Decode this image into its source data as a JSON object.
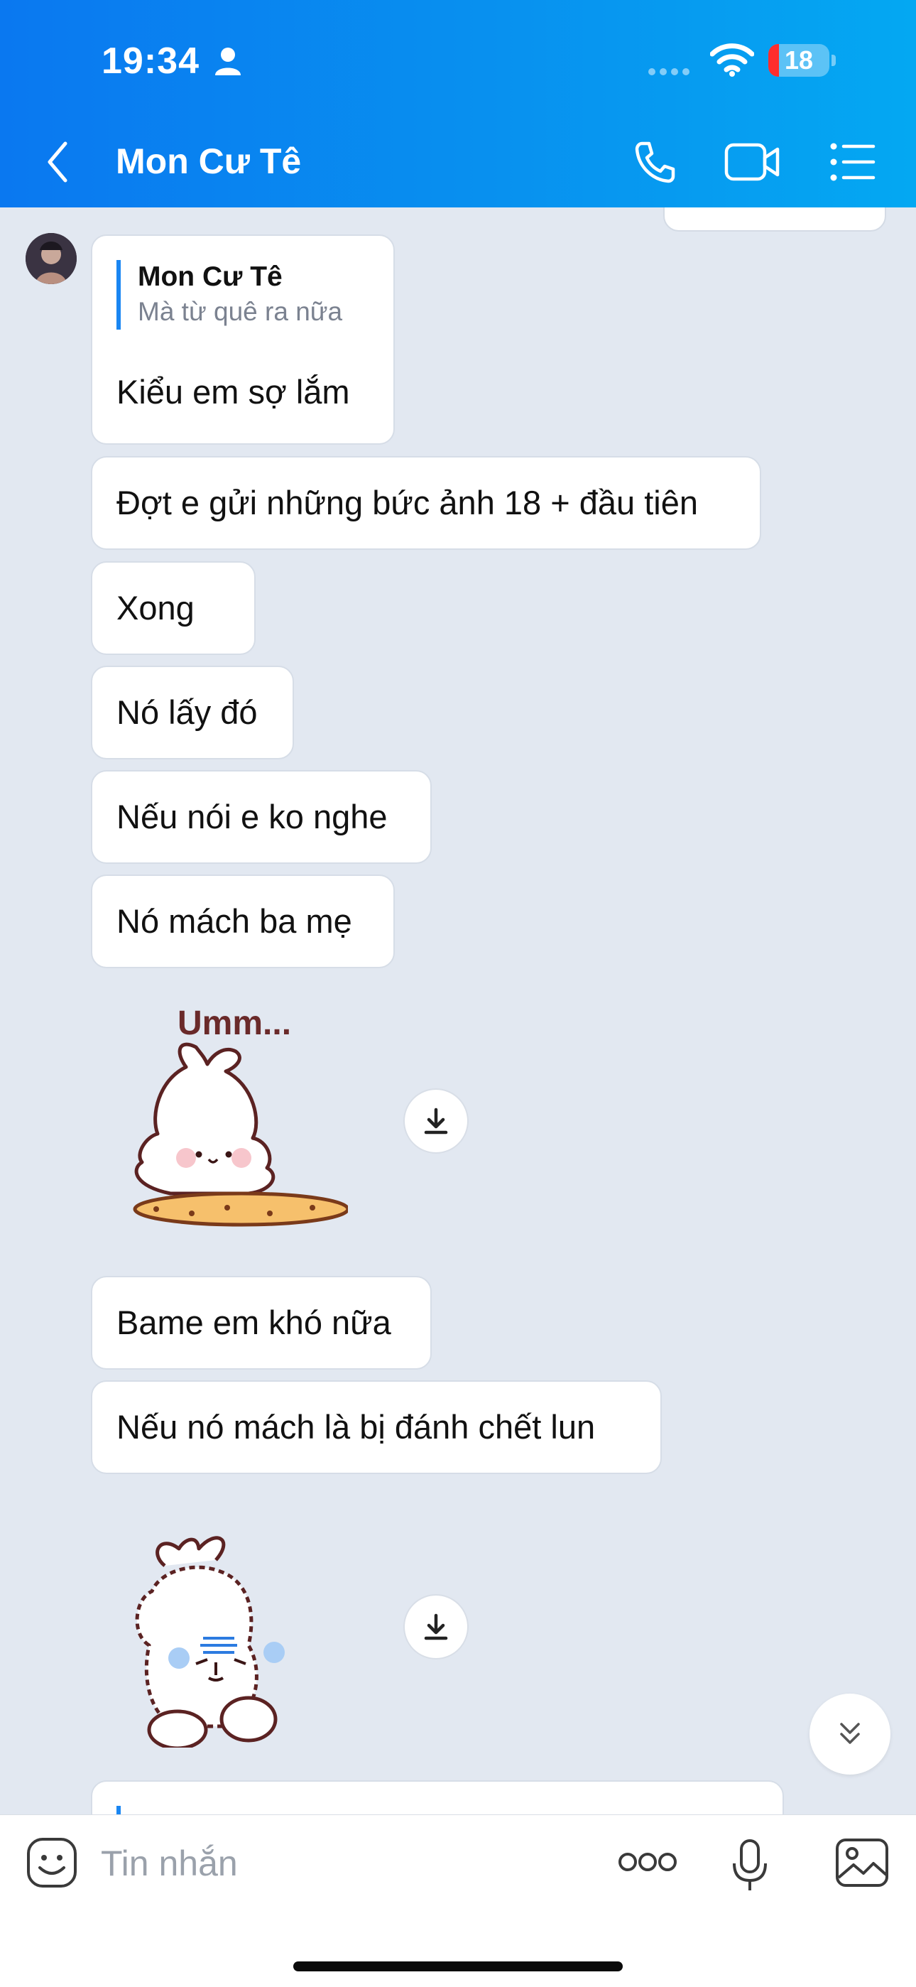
{
  "status_bar": {
    "time": "19:34",
    "battery": "18",
    "battery_level": 0.18
  },
  "header": {
    "title": "Mon Cư Tê"
  },
  "messages": [
    {
      "type": "text",
      "quote_author": "Mon Cư Tê",
      "quote_text": "Mà từ quê ra nữa",
      "text": "Kiểu em sợ lắm"
    },
    {
      "type": "text",
      "text": "Đợt e gửi những bức ảnh 18 + đầu tiên"
    },
    {
      "type": "text",
      "text": "Xong"
    },
    {
      "type": "text",
      "text": "Nó lấy đó"
    },
    {
      "type": "text",
      "text": "Nếu nói e ko nghe"
    },
    {
      "type": "text",
      "text": "Nó mách ba mẹ"
    },
    {
      "type": "sticker",
      "caption": "Umm..."
    },
    {
      "type": "text",
      "text": "Bame em khó nữa"
    },
    {
      "type": "text",
      "text": "Nếu nó mách là bị đánh chết lun"
    },
    {
      "type": "sticker",
      "caption": ""
    }
  ],
  "input": {
    "placeholder": "Tin nhắn"
  },
  "colors": {
    "header_start": "#0a78f0",
    "header_end": "#04a8f2",
    "chat_bg": "#e2e8f1",
    "quote_bar": "#1a86f2"
  }
}
